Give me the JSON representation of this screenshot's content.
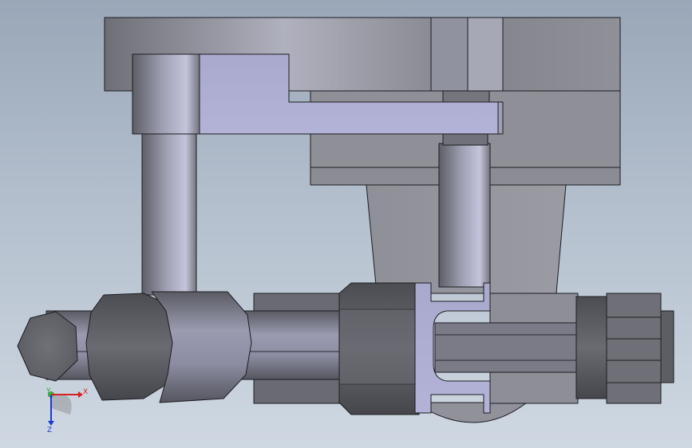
{
  "viewport": {
    "background_top": "#9aa7b8",
    "background_bottom": "#cfd8e2"
  },
  "triad": {
    "x_label": "X",
    "y_label": "Y",
    "z_label": "Z",
    "x_color": "#d42020",
    "y_color": "#20b020",
    "z_color": "#1a3ad0"
  },
  "colors": {
    "housing": "#8d8f97",
    "lever": "#aaaacf",
    "shaft": "#8f90a8",
    "clevis": "#b4b4dc",
    "dark_part": "#5d5d63"
  }
}
